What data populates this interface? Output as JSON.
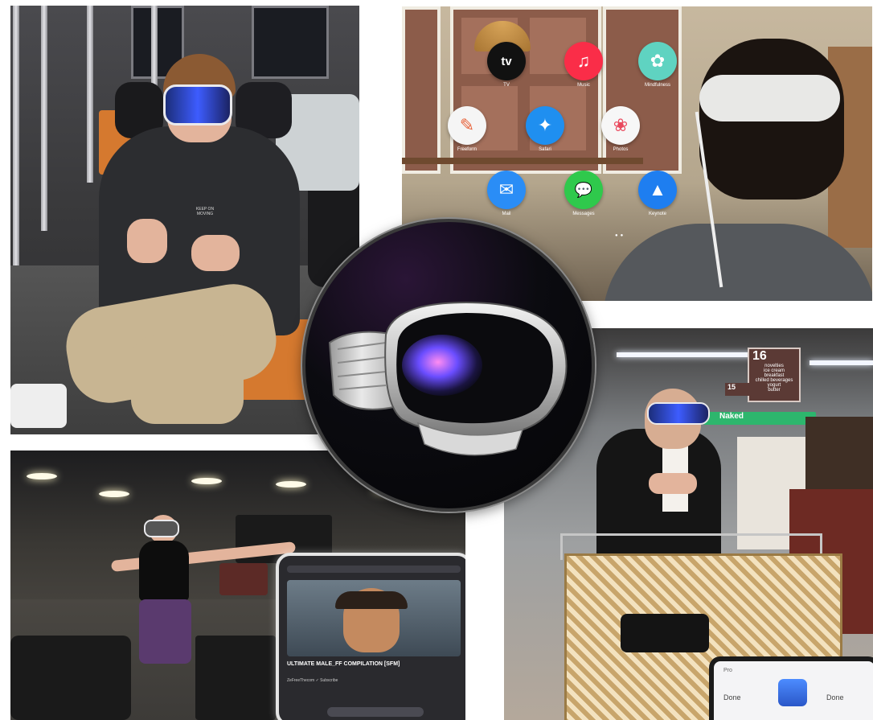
{
  "room": {
    "apps": [
      {
        "name": "TV",
        "glyph": "tv",
        "color": "#111111"
      },
      {
        "name": "Music",
        "glyph": "♫",
        "color": "#fa2d48"
      },
      {
        "name": "Mindfulness",
        "glyph": "✿",
        "color": "#5fd3c1"
      },
      {
        "name": "Freeform",
        "glyph": "✎",
        "color": "#f5f5f5"
      },
      {
        "name": "Safari",
        "glyph": "✦",
        "color": "#1f8ff0"
      },
      {
        "name": "Photos",
        "glyph": "❀",
        "color": "#f7f7f7"
      },
      {
        "name": "Mail",
        "glyph": "✉",
        "color": "#2a8df6"
      },
      {
        "name": "Messages",
        "glyph": "💬",
        "color": "#2fc94c"
      },
      {
        "name": "Keynote",
        "glyph": "▲",
        "color": "#1e7ef0"
      }
    ]
  },
  "hoodie_text": "KEEP ON MOVING",
  "gym": {
    "video_title": "ULTIMATE MALE_FF COMPILATION [SFM]",
    "video_meta": "ZeFreeThecom ✓   Subscribe"
  },
  "store": {
    "aisle_16": {
      "number": "16",
      "items": [
        "novelties",
        "ice cream",
        "breakfast",
        "chilled beverages",
        "yogurt",
        "butter"
      ]
    },
    "aisle_15": "15",
    "brand_sign": "Naked",
    "phone": {
      "brand": "Pro",
      "left_label": "Done",
      "right_label": "Done"
    }
  }
}
